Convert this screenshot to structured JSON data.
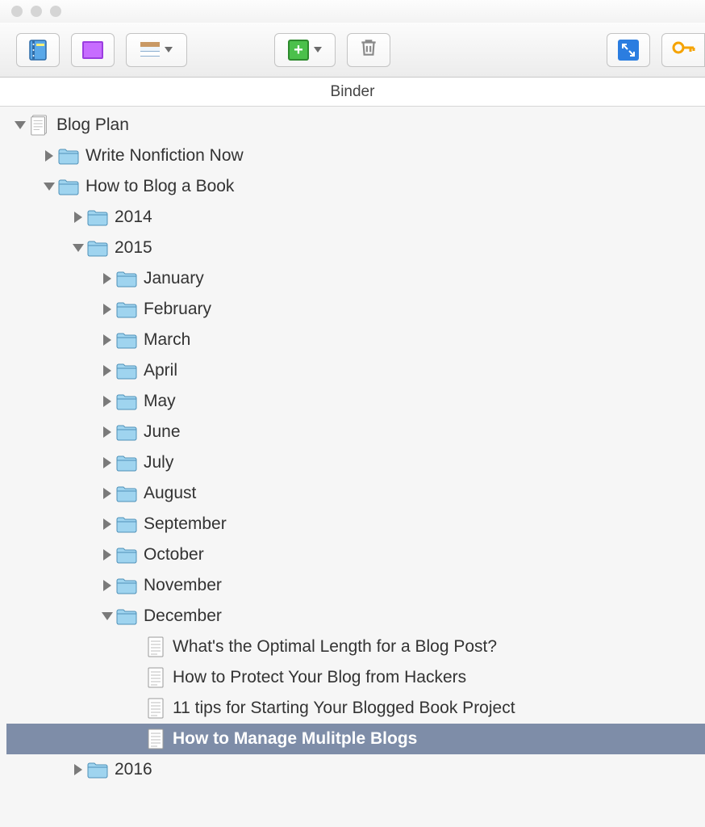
{
  "header": {
    "title": "Binder"
  },
  "toolbar": {
    "binder_button": "binder-view",
    "corkboard_button": "corkboard-view",
    "outliner_button": "outliner-view",
    "add_button": "add-item",
    "trash_button": "trash",
    "fullscreen_button": "compose-fullscreen",
    "key_button": "keywords"
  },
  "tree": {
    "root": {
      "label": "Blog Plan",
      "type": "draft",
      "expanded": true,
      "children": [
        {
          "label": "Write Nonfiction Now",
          "type": "folder",
          "expanded": false,
          "children": []
        },
        {
          "label": "How to Blog a Book",
          "type": "folder",
          "expanded": true,
          "children": [
            {
              "label": "2014",
              "type": "folder",
              "expanded": false,
              "children": []
            },
            {
              "label": "2015",
              "type": "folder",
              "expanded": true,
              "children": [
                {
                  "label": "January",
                  "type": "folder",
                  "expanded": false,
                  "children": []
                },
                {
                  "label": "February",
                  "type": "folder",
                  "expanded": false,
                  "children": []
                },
                {
                  "label": "March",
                  "type": "folder",
                  "expanded": false,
                  "children": []
                },
                {
                  "label": "April",
                  "type": "folder",
                  "expanded": false,
                  "children": []
                },
                {
                  "label": "May",
                  "type": "folder",
                  "expanded": false,
                  "children": []
                },
                {
                  "label": "June",
                  "type": "folder",
                  "expanded": false,
                  "children": []
                },
                {
                  "label": "July",
                  "type": "folder",
                  "expanded": false,
                  "children": []
                },
                {
                  "label": "August",
                  "type": "folder",
                  "expanded": false,
                  "children": []
                },
                {
                  "label": "September",
                  "type": "folder",
                  "expanded": false,
                  "children": []
                },
                {
                  "label": "October",
                  "type": "folder",
                  "expanded": false,
                  "children": []
                },
                {
                  "label": "November",
                  "type": "folder",
                  "expanded": false,
                  "children": []
                },
                {
                  "label": "December",
                  "type": "folder",
                  "expanded": true,
                  "children": [
                    {
                      "label": "What's the Optimal Length for a Blog Post?",
                      "type": "document"
                    },
                    {
                      "label": "How to Protect Your Blog from Hackers",
                      "type": "document"
                    },
                    {
                      "label": "11 tips for Starting Your Blogged Book Project",
                      "type": "document"
                    },
                    {
                      "label": "How to Manage Mulitple Blogs",
                      "type": "document",
                      "selected": true
                    }
                  ]
                }
              ]
            },
            {
              "label": "2016",
              "type": "folder",
              "expanded": false,
              "children": []
            }
          ]
        }
      ]
    }
  }
}
